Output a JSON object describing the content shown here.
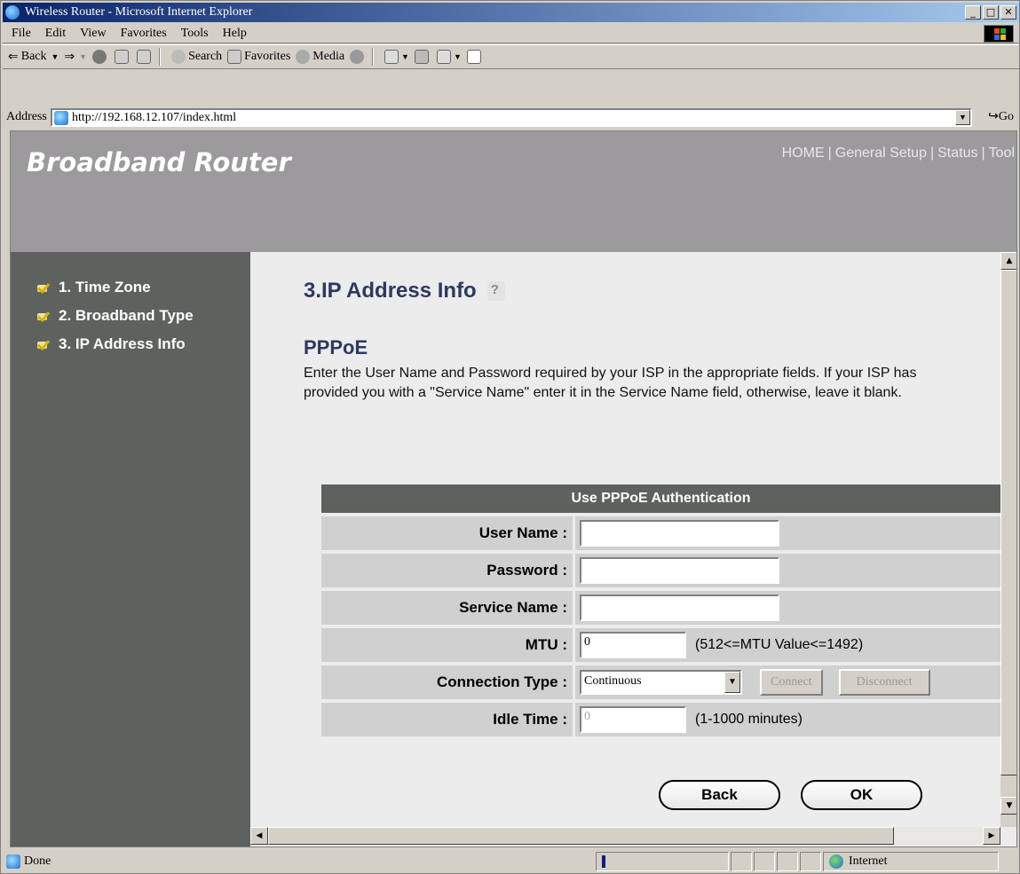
{
  "window": {
    "title": "Wireless Router - Microsoft Internet Explorer"
  },
  "menu": [
    "File",
    "Edit",
    "View",
    "Favorites",
    "Tools",
    "Help"
  ],
  "toolbar": {
    "back": "Back",
    "search": "Search",
    "favorites": "Favorites",
    "media": "Media"
  },
  "address": {
    "label": "Address",
    "url": "http://192.168.12.107/index.html",
    "go": "Go"
  },
  "header": {
    "brand": "Broadband Router",
    "nav": [
      "HOME",
      "General Setup",
      "Status",
      "Tool"
    ]
  },
  "sidebar": {
    "items": [
      "1. Time Zone",
      "2. Broadband Type",
      "3. IP Address Info"
    ]
  },
  "main": {
    "title": "3.IP Address Info",
    "subtitle": "PPPoE",
    "description": "Enter the User Name and Password required by your ISP in the appropriate fields. If your ISP has provided you with a \"Service Name\" enter it in the Service Name field, otherwise, leave it blank.",
    "table_header": "Use PPPoE Authentication",
    "labels": {
      "username": "User Name :",
      "password": "Password :",
      "service": "Service Name :",
      "mtu": "MTU :",
      "conntype": "Connection Type :",
      "idle": "Idle Time :"
    },
    "values": {
      "username": "",
      "password": "",
      "service": "",
      "mtu": "0",
      "conntype": "Continuous",
      "idle": "0"
    },
    "notes": {
      "mtu": "(512<=MTU Value<=1492)",
      "idle": "(1-1000 minutes)"
    },
    "buttons": {
      "connect": "Connect",
      "disconnect": "Disconnect",
      "back": "Back",
      "ok": "OK"
    }
  },
  "status": {
    "text": "Done",
    "zone": "Internet"
  }
}
